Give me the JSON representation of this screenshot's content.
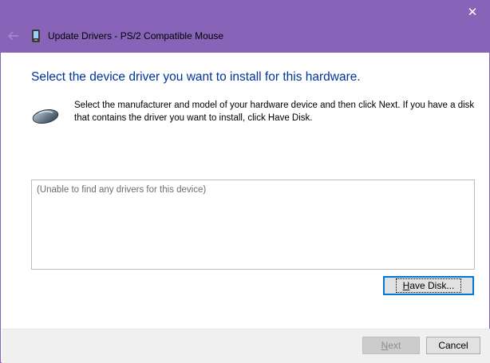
{
  "window": {
    "title": "Update Drivers - PS/2 Compatible Mouse",
    "close_glyph": "✕",
    "accent_color": "#8764b8"
  },
  "icons": {
    "back": "back-arrow-icon",
    "app": "device-icon",
    "mouse": "mouse-icon",
    "close": "close-icon"
  },
  "main": {
    "heading": "Select the device driver you want to install for this hardware.",
    "description": "Select the manufacturer and model of your hardware device and then click Next. If you have a disk that contains the driver you want to install, click Have Disk.",
    "driver_list": {
      "empty_text": "(Unable to find any drivers for this device)"
    },
    "have_disk": {
      "underline_char": "H",
      "rest": "ave Disk..."
    }
  },
  "footer": {
    "next": {
      "underline_char": "N",
      "rest": "ext",
      "disabled": true
    },
    "cancel_label": "Cancel"
  }
}
